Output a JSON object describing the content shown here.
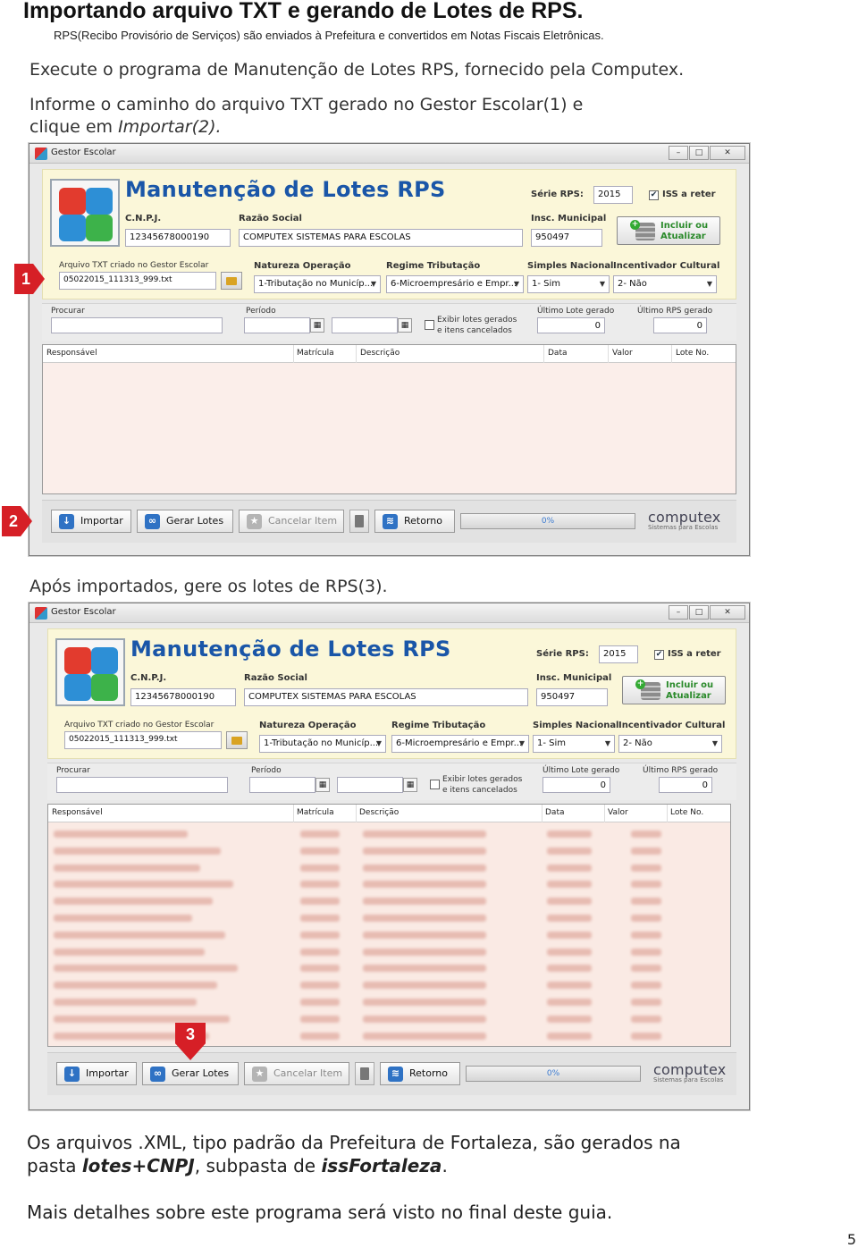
{
  "header": {
    "title": "Importando arquivo TXT e gerando de Lotes de RPS.",
    "subtitle": "RPS(Recibo Provisório de Serviços) são enviados à Prefeitura e convertidos em Notas Fiscais Eletrônicas."
  },
  "instructions": {
    "step1": "Execute o programa de Manutenção de Lotes RPS, fornecido pela Computex.",
    "step2_line1": "Informe o caminho do arquivo TXT gerado no Gestor Escolar(1) e",
    "step2_line2_prefix": "clique em ",
    "step2_line2_em": "Importar(2).",
    "step3": "Após importados, gere os lotes de RPS(3)."
  },
  "footer": {
    "line1": "Os arquivos .XML, tipo padrão da Prefeitura de Fortaleza, são gerados na",
    "line2_prefix": "pasta ",
    "line2_bold1": "lotes+CNPJ",
    "line2_mid": ", subpasta de ",
    "line2_bold2": "issFortaleza",
    "line2_end": ".",
    "line3": "Mais detalhes sobre este programa será visto no final deste guia.",
    "page_number": "5"
  },
  "markers": {
    "m1": "1",
    "m2": "2",
    "m3": "3"
  },
  "app": {
    "window_title": "Gestor Escolar",
    "app_title": "Manutenção de Lotes RPS",
    "serie_label": "Série RPS:",
    "serie_value": "2015",
    "iss_label": "ISS a reter",
    "iss_checked": true,
    "cnpj_label": "C.N.P.J.",
    "cnpj_value": "12345678000190",
    "razao_label": "Razão Social",
    "razao_value": "COMPUTEX SISTEMAS PARA ESCOLAS",
    "insc_label": "Insc. Municipal",
    "insc_value": "950497",
    "incluir_line1": "Incluir ou",
    "incluir_line2": "Atualizar",
    "arquivo_label": "Arquivo TXT criado no Gestor Escolar",
    "arquivo_value": "05022015_111313_999.txt",
    "natureza_label": "Natureza Operação",
    "natureza_value": "1-Tributação no Municíp...",
    "regime_label": "Regime Tributação",
    "regime_value": "6-Microempresário e Empr...",
    "simples_label": "Simples Nacional",
    "simples_value": "1- Sim",
    "incentivador_label": "Incentivador Cultural",
    "incentivador_value": "2- Não",
    "procurar_label": "Procurar",
    "periodo_label": "Período",
    "exibir_line1": "Exibir lotes gerados",
    "exibir_line2": "e itens cancelados",
    "ultimo_lote_label": "Último Lote gerado",
    "ultimo_lote_value": "0",
    "ultimo_rps_label": "Último RPS gerado",
    "ultimo_rps_value": "0",
    "columns": [
      "Responsável",
      "Matrícula",
      "Descrição",
      "Data",
      "Valor",
      "Lote No."
    ],
    "buttons": {
      "importar": "Importar",
      "gerar": "Gerar Lotes",
      "cancelar": "Cancelar Item",
      "retorno": "Retorno"
    },
    "progress": "0%",
    "progress_fraction": 0,
    "brand": "computex",
    "brand_tagline": "Sistemas para Escolas"
  }
}
